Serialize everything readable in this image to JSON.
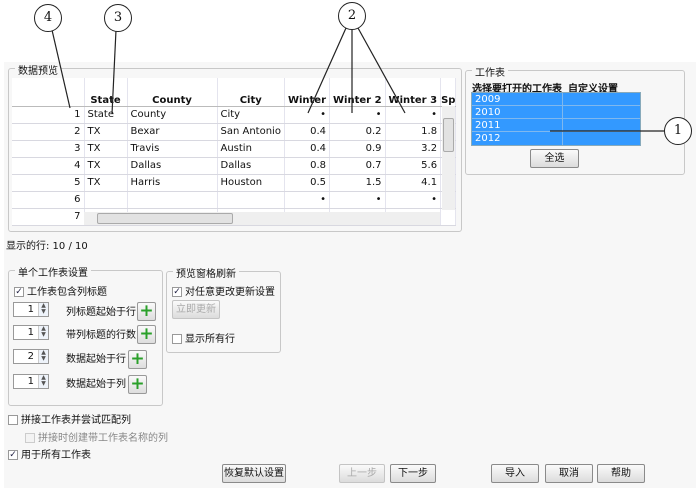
{
  "callouts": [
    "1",
    "2",
    "3",
    "4"
  ],
  "preview": {
    "title": "数据预览",
    "columns": [
      "State",
      "County",
      "City",
      "Winter",
      "Winter 2",
      "Winter 3",
      "Sp"
    ],
    "rows": [
      [
        "1",
        "State",
        "County",
        "City",
        "•",
        "•",
        "•"
      ],
      [
        "2",
        "TX",
        "Bexar",
        "San Antonio",
        "0.4",
        "0.2",
        "1.8"
      ],
      [
        "3",
        "TX",
        "Travis",
        "Austin",
        "0.4",
        "0.9",
        "3.2"
      ],
      [
        "4",
        "TX",
        "Dallas",
        "Dallas",
        "0.8",
        "0.7",
        "5.6"
      ],
      [
        "5",
        "TX",
        "Harris",
        "Houston",
        "0.5",
        "1.5",
        "4.1"
      ],
      [
        "6",
        "",
        "",
        "",
        "•",
        "•",
        "•"
      ],
      [
        "7",
        "",
        "",
        "",
        "•",
        "•",
        "•"
      ]
    ],
    "rows_shown": "显示的行: 10 / 10"
  },
  "worksheets": {
    "title": "工作表",
    "col_select": "选择要打开的工作表",
    "col_custom": "自定义设置",
    "items": [
      "2009",
      "2010",
      "2011",
      "2012"
    ],
    "select_all": "全选"
  },
  "single": {
    "title": "单个工作表设置",
    "has_headers": "工作表包含列标题",
    "header_row_label": "列标题起始于行",
    "header_row": "1",
    "header_rows_count_label": "带列标题的行数",
    "header_rows_count": "1",
    "data_row_label": "数据起始于行",
    "data_row": "2",
    "data_col_label": "数据起始于列",
    "data_col": "1"
  },
  "refresh": {
    "title": "预览窗格刷新",
    "auto": "对任意更改更新设置",
    "update_now": "立即更新",
    "show_all": "显示所有行"
  },
  "stack": "拼接工作表并尝试匹配列",
  "stack_col": "拼接时创建带工作表名称的列",
  "use_all": "用于所有工作表",
  "buttons": {
    "restore": "恢复默认设置",
    "back": "上一步",
    "next": "下一步",
    "import": "导入",
    "cancel": "取消",
    "help": "帮助"
  }
}
